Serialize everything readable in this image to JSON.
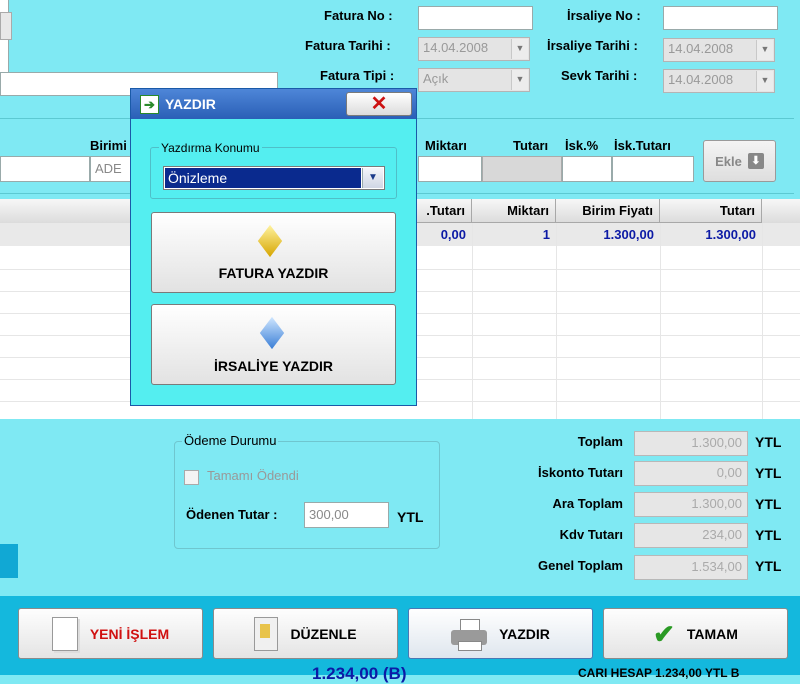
{
  "header": {
    "fatura_no_label": "Fatura No :",
    "fatura_no_value": "",
    "fatura_tarihi_label": "Fatura Tarihi :",
    "fatura_tarihi_value": "14.04.2008",
    "fatura_tipi_label": "Fatura Tipi :",
    "fatura_tipi_value": "Açık",
    "irsaliye_no_label": "İrsaliye No :",
    "irsaliye_no_value": "",
    "irsaliye_tarihi_label": "İrsaliye Tarihi :",
    "irsaliye_tarihi_value": "14.04.2008",
    "sevk_tarihi_label": "Sevk Tarihi :",
    "sevk_tarihi_value": "14.04.2008"
  },
  "entry": {
    "birimi_label": "Birimi",
    "birimi_value": "ADE",
    "miktar_label": "Miktarı",
    "tutar_label": "Tutarı",
    "isk_label": "İsk.%",
    "isk_tutar_label": "İsk.Tutarı",
    "ekle_label": "Ekle"
  },
  "grid": {
    "columns": [
      ".Tutarı",
      "Miktarı",
      "Birim Fiyatı",
      "Tutarı"
    ],
    "rows": [
      [
        "0,00",
        "1",
        "1.300,00",
        "1.300,00"
      ]
    ]
  },
  "odeme": {
    "group_label": "Ödeme Durumu",
    "tamami_label": "Tamamı Ödendi",
    "odenen_label": "Ödenen Tutar :",
    "odenen_value": "300,00",
    "currency": "YTL"
  },
  "totals": [
    {
      "label": "Toplam",
      "value": "1.300,00",
      "currency": "YTL"
    },
    {
      "label": "İskonto Tutarı",
      "value": "0,00",
      "currency": "YTL"
    },
    {
      "label": "Ara Toplam",
      "value": "1.300,00",
      "currency": "YTL"
    },
    {
      "label": "Kdv Tutarı",
      "value": "234,00",
      "currency": "YTL"
    },
    {
      "label": "Genel Toplam",
      "value": "1.534,00",
      "currency": "YTL"
    }
  ],
  "buttons": {
    "yeni": "YENİ İŞLEM",
    "duzenle": "DÜZENLE",
    "yazdir": "YAZDIR",
    "tamam": "TAMAM"
  },
  "footer": {
    "left": "1.234,00 (B)",
    "right": "CARI HESAP 1.234,00 YTL B"
  },
  "dialog": {
    "title": "YAZDIR",
    "group_label": "Yazdırma Konumu",
    "select_value": "Önizleme",
    "fatura_btn": "FATURA YAZDIR",
    "irsaliye_btn": "İRSALİYE YAZDIR"
  },
  "colors": {
    "background": "#7fe9f3",
    "grid_value": "#0c1aa5",
    "yeni_red": "#d01010",
    "tamam_green": "#2a9a24",
    "close_red": "#cc1111"
  }
}
